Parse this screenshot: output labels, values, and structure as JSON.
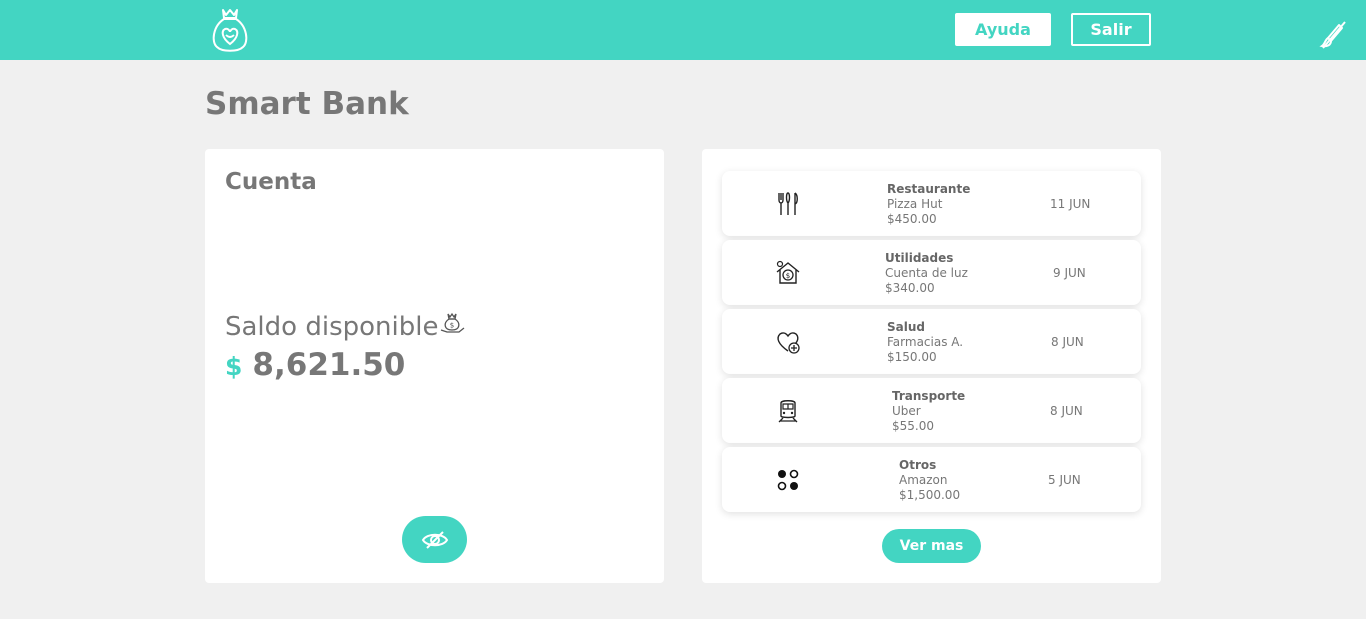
{
  "brand": {
    "accent_color": "#43d5c2",
    "logo_icon": "money-bag-logo-icon"
  },
  "header": {
    "help_label": "Ayuda",
    "exit_label": "Salir",
    "theme_icon": "no-brush-icon"
  },
  "page": {
    "title": "Smart Bank"
  },
  "account": {
    "title": "Cuenta",
    "balance_label": "Saldo disponible",
    "currency_symbol": "$",
    "balance": "8,621.50",
    "toggle_icon": "eye-slash-icon"
  },
  "transactions": {
    "items": [
      {
        "category": "Restaurante",
        "merchant": "Pizza Hut",
        "amount": "$450.00",
        "date": "11 JUN",
        "icon": "cutlery-icon"
      },
      {
        "category": "Utilidades",
        "merchant": "Cuenta de luz",
        "amount": "$340.00",
        "date": "9 JUN",
        "icon": "house-bill-icon"
      },
      {
        "category": "Salud",
        "merchant": "Farmacias A.",
        "amount": "$150.00",
        "date": "8 JUN",
        "icon": "heart-plus-icon"
      },
      {
        "category": "Transporte",
        "merchant": "Uber",
        "amount": "$55.00",
        "date": "8 JUN",
        "icon": "train-icon"
      },
      {
        "category": "Otros",
        "merchant": "Amazon",
        "amount": "$1,500.00",
        "date": "5 JUN",
        "icon": "dots-grid-icon"
      }
    ],
    "more_label": "Ver mas"
  }
}
